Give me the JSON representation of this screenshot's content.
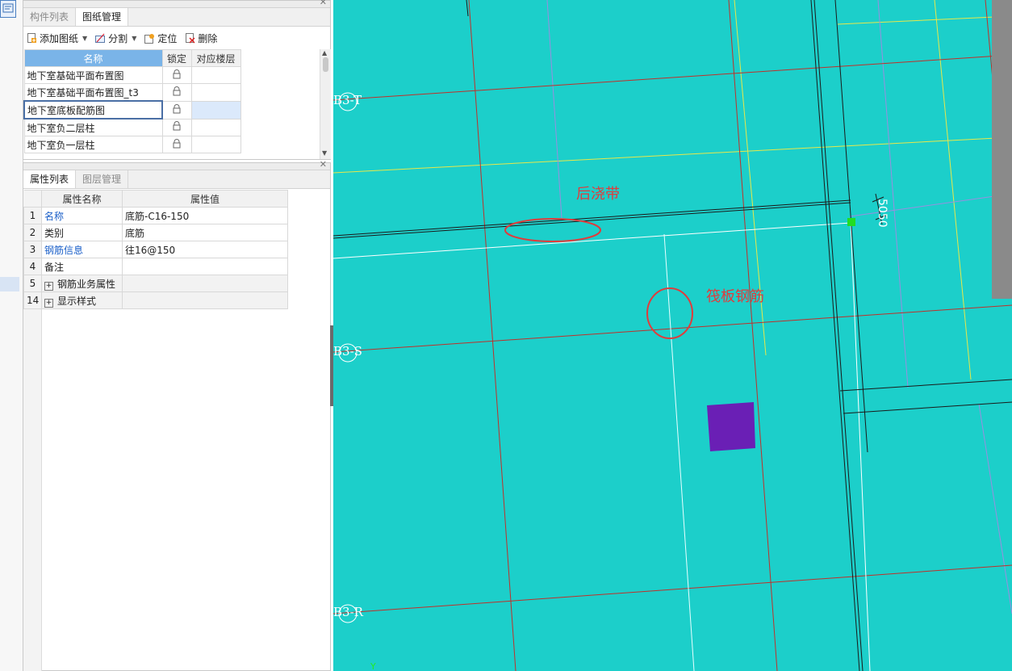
{
  "drawing_panel": {
    "tabs": [
      "构件列表",
      "图纸管理"
    ],
    "active_tab": 1,
    "toolbar": {
      "add_drawing": "添加图纸",
      "split": "分割",
      "locate": "定位",
      "delete": "删除"
    },
    "columns": [
      "名称",
      "锁定",
      "对应楼层"
    ],
    "rows": [
      {
        "name": "地下室基础平面布置图",
        "floor": ""
      },
      {
        "name": "地下室基础平面布置图_t3",
        "floor": ""
      },
      {
        "name": "地下室底板配筋图",
        "floor": ""
      },
      {
        "name": "地下室负二层柱",
        "floor": ""
      },
      {
        "name": "地下室负一层柱",
        "floor": ""
      }
    ],
    "selected_row": 2
  },
  "property_panel": {
    "tabs": [
      "属性列表",
      "图层管理"
    ],
    "active_tab": 0,
    "columns": [
      "属性名称",
      "属性值"
    ],
    "rows": [
      {
        "num": "1",
        "name": "名称",
        "value": "底筋-C16-150"
      },
      {
        "num": "2",
        "name": "类别",
        "value": "底筋"
      },
      {
        "num": "3",
        "name": "钢筋信息",
        "value": "往16@150"
      },
      {
        "num": "4",
        "name": "备注",
        "value": ""
      },
      {
        "num": "5",
        "name": "钢筋业务属性",
        "value": ""
      },
      {
        "num": "14",
        "name": "显示样式",
        "value": ""
      }
    ],
    "blue_label_color": "#1a5fc8"
  },
  "canvas": {
    "background": "#1ccfca",
    "axis_labels": [
      "B3-T",
      "B3-S",
      "B3-R"
    ],
    "dimension": "5050",
    "annotations": [
      "后浇带",
      "筏板钢筋"
    ],
    "annotation_color": "#e03c3c"
  }
}
